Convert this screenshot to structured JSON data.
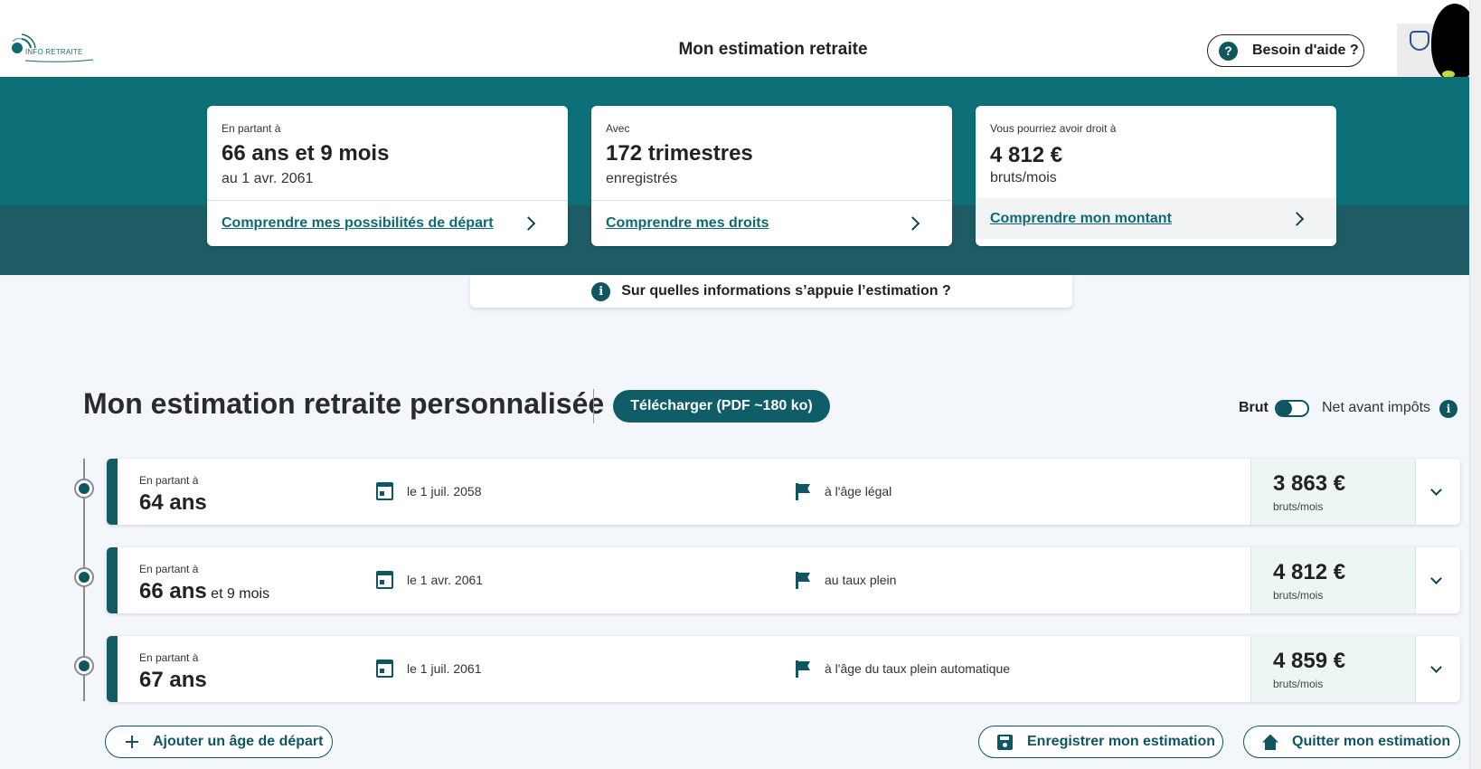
{
  "header": {
    "logo_text": "INFO RETRAITE",
    "title": "Mon estimation retraite",
    "help_label": "Besoin d'aide ?",
    "help_icon_glyph": "?"
  },
  "summary": {
    "cards": [
      {
        "kicker": "En partant à",
        "main": "66 ans et 9 mois",
        "sub": "au 1 avr. 2061",
        "link": "Comprendre mes possibilités de départ"
      },
      {
        "kicker": "Avec",
        "main": "172 trimestres",
        "sub": "enregistrés",
        "link": "Comprendre mes droits"
      },
      {
        "kicker": "Vous pourriez avoir droit à",
        "main": "4 812 €",
        "sub": "bruts/mois",
        "link": "Comprendre mon montant"
      }
    ],
    "info_bar_label": "Sur quelles informations s’appuie l’estimation ?",
    "info_glyph": "i"
  },
  "section": {
    "title": "Mon estimation retraite personnalisée",
    "download_label": "Télécharger (PDF ~180 ko)",
    "brut_label": "Brut",
    "net_label": "Net avant impôts",
    "toggle_state": "Brut"
  },
  "rows": [
    {
      "kicker": "En partant à",
      "age": "64 ans",
      "age_extra": "",
      "date": "le 1 juil. 2058",
      "reason": "à l'âge légal",
      "amount": "3 863 €",
      "unit": "bruts/mois"
    },
    {
      "kicker": "En partant à",
      "age": "66 ans",
      "age_extra": " et 9 mois",
      "date": "le 1 avr. 2061",
      "reason": "au taux plein",
      "amount": "4 812 €",
      "unit": "bruts/mois"
    },
    {
      "kicker": "En partant à",
      "age": "67 ans",
      "age_extra": "",
      "date": "le 1 juil. 2061",
      "reason": "à l'âge du taux plein automatique",
      "amount": "4 859 €",
      "unit": "bruts/mois"
    }
  ],
  "actions": {
    "add_label": "Ajouter un âge de départ",
    "save_label": "Enregistrer mon estimation",
    "quit_label": "Quitter mon estimation"
  },
  "colors": {
    "primary": "#0f5661",
    "band_top": "#0d7079",
    "band_bottom": "#1d5c64",
    "light_bg": "#f3f7fb"
  }
}
